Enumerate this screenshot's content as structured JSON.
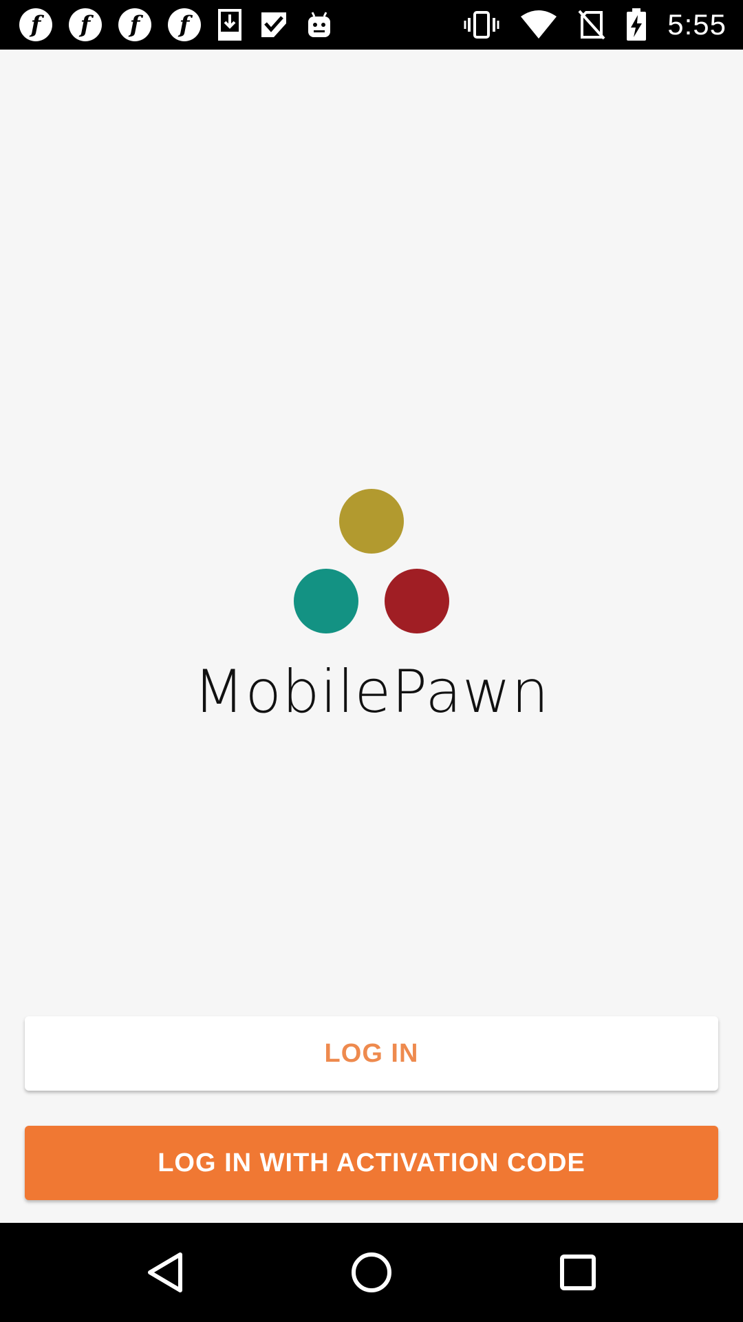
{
  "status_bar": {
    "left_icons": [
      "facebook-icon",
      "facebook-icon",
      "facebook-icon",
      "facebook-icon",
      "download-icon",
      "checkmark-icon",
      "android-icon"
    ],
    "fb_glyph": "f",
    "right_icons": [
      "vibrate-icon",
      "wifi-icon",
      "no-sim-icon",
      "battery-charging-icon"
    ],
    "time": "5:55"
  },
  "logo": {
    "text": "MobilePawn",
    "colors": {
      "gold": "#b29a2f",
      "teal": "#139283",
      "red": "#a01e24"
    }
  },
  "buttons": {
    "login_label": "LOG IN",
    "activation_label": "LOG IN WITH ACTIVATION CODE"
  },
  "accent_color": "#f07833",
  "nav_bar": {
    "icons": [
      "back-icon",
      "home-icon",
      "recents-icon"
    ]
  }
}
